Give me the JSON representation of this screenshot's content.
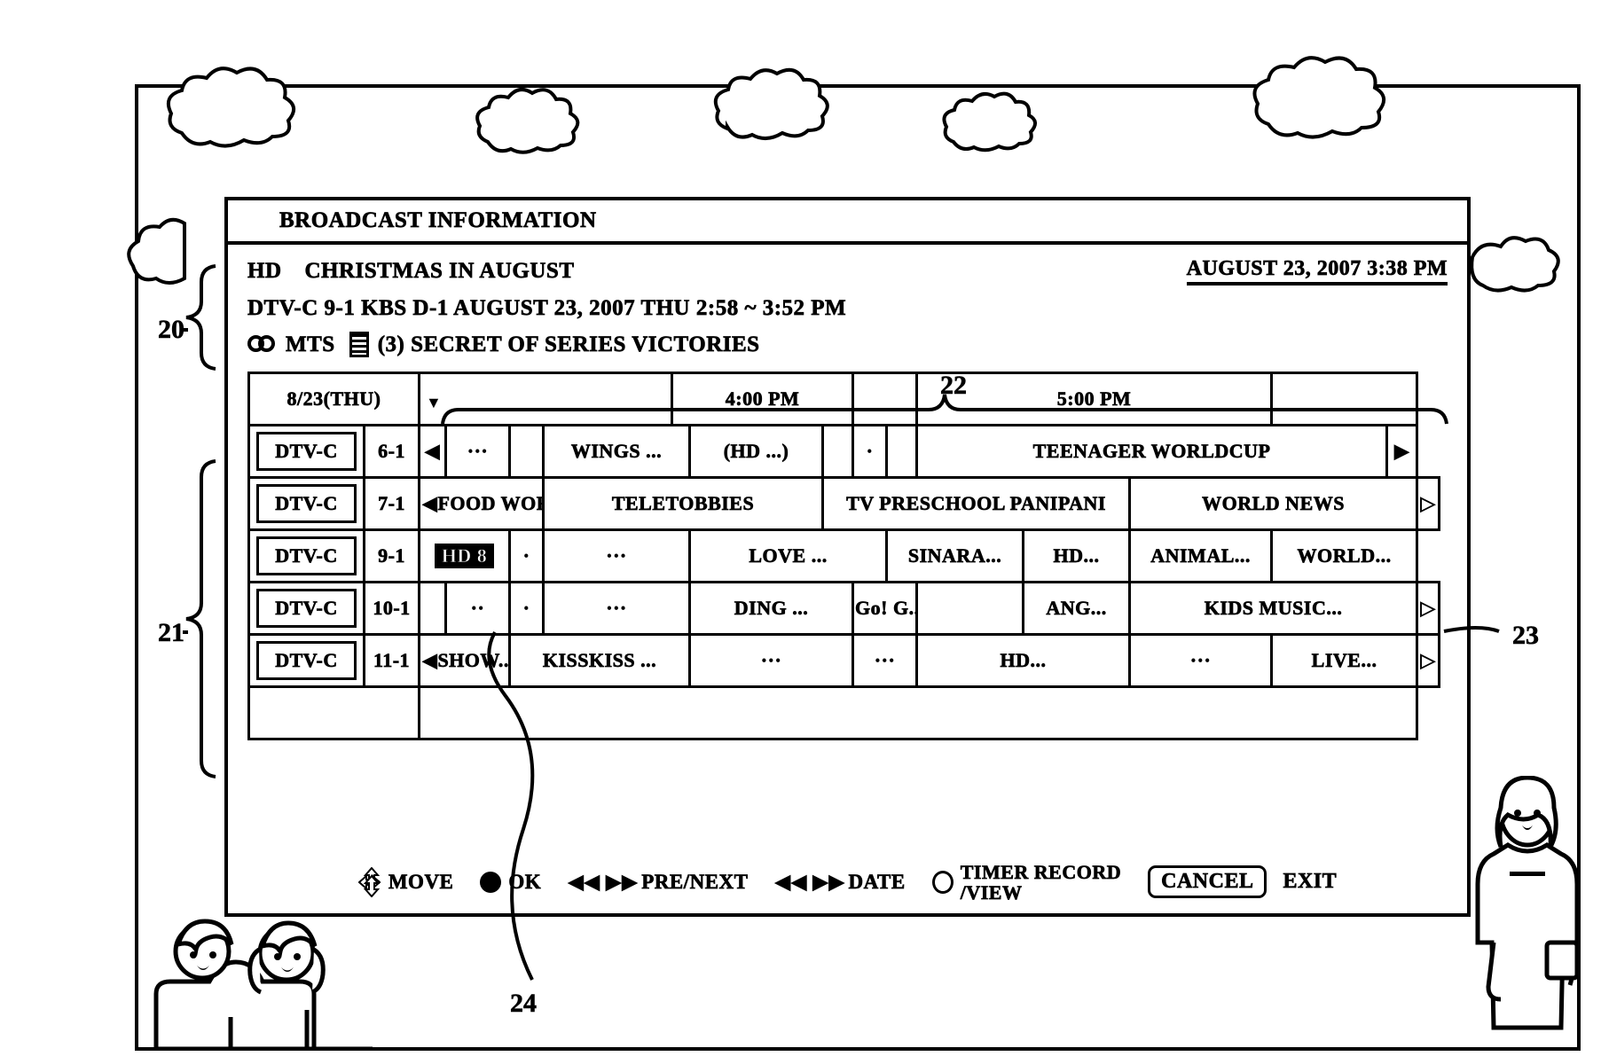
{
  "panel": {
    "title": "BROADCAST INFORMATION",
    "header_datetime": "AUGUST 23, 2007 3:38 PM"
  },
  "info": {
    "hd_badge": "HD",
    "program_title": "CHRISTMAS IN AUGUST",
    "channel_line": "DTV-C 9-1   KBS D-1 AUGUST 23, 2007 THU 2:58 ~ 3:52 PM",
    "mts_label": "MTS",
    "episode_line": "(3) SECRET OF SERIES VICTORIES",
    "stereo_icon": "stereo-icon",
    "caption_icon": "closed-caption-icon"
  },
  "grid": {
    "day_label": "8/23(THU)",
    "time_headers": [
      "",
      "4:00 PM",
      "",
      "5:00 PM",
      ""
    ],
    "current_time_marker": "▼",
    "rows": [
      {
        "source": "DTV-C",
        "number": "6-1",
        "left_arrow": "◀",
        "right_arrow": "▶",
        "programs": [
          "···",
          "WINGS ...",
          "(HD ...)",
          "·",
          "",
          "TEENAGER WORLDCUP"
        ]
      },
      {
        "source": "DTV-C",
        "number": "7-1",
        "left_arrow": "◀",
        "right_arrow": "▷",
        "programs": [
          "FOOD WORLD",
          "TELETOBBIES",
          "TV PRESCHOOL PANIPANI",
          "WORLD NEWS"
        ]
      },
      {
        "source": "DTV-C",
        "number": "9-1",
        "left_arrow": "",
        "right_arrow": "",
        "selected_program": "HD 8",
        "programs": [
          "·",
          "···",
          "LOVE ...",
          "SINARA...",
          "HD...",
          "ANIMAL...",
          "WORLD..."
        ]
      },
      {
        "source": "DTV-C",
        "number": "10-1",
        "left_arrow": "",
        "right_arrow": "▷",
        "programs": [
          "··",
          "·",
          "···",
          "DING ...",
          "Go! G...",
          "ANG...",
          "KIDS MUSIC..."
        ]
      },
      {
        "source": "DTV-C",
        "number": "11-1",
        "left_arrow": "◀",
        "right_arrow": "▷",
        "programs": [
          "SHOW...",
          "KISSKISS ...",
          "···",
          "···",
          "HD...",
          "···",
          "LIVE..."
        ]
      }
    ]
  },
  "footer": {
    "move_label": "MOVE",
    "ok_label": "OK",
    "prenext_arrows": "◀◀ ▶▶",
    "prenext_label": "PRE/NEXT",
    "date_arrows": "◀◀ ▶▶",
    "date_label": "DATE",
    "timer_line1": "TIMER RECORD",
    "timer_line2": "/VIEW",
    "cancel_label": "CANCEL",
    "exit_label": "EXIT"
  },
  "references": {
    "r20": "20",
    "r21": "21",
    "r22": "22",
    "r23": "23",
    "r24": "24"
  },
  "colors": {
    "ink": "#000000",
    "paper": "#ffffff"
  }
}
